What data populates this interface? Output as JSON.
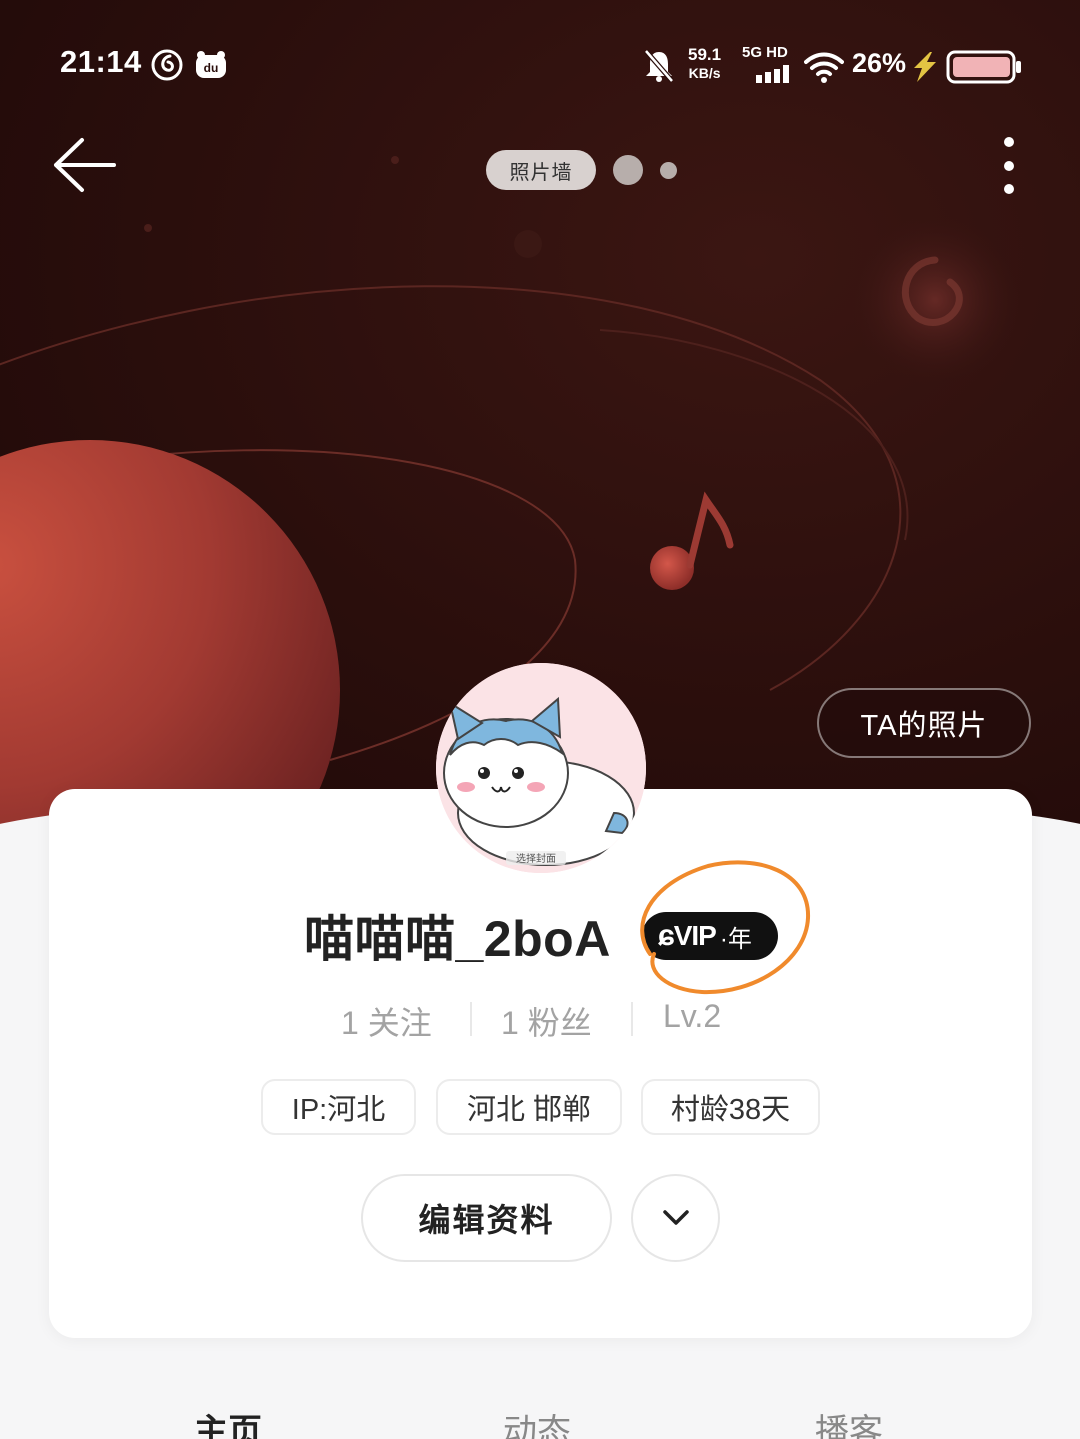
{
  "status_bar": {
    "time": "21:14",
    "speed_value": "59.1",
    "speed_unit": "KB/s",
    "network_top": "5G HD",
    "battery_percent": "26%",
    "icons": [
      "netease-music-icon",
      "du-app-icon",
      "mute-bell-icon",
      "signal-icon",
      "wifi-icon",
      "charging-icon",
      "battery-icon"
    ]
  },
  "nav": {
    "photo_wall_label": "照片墙",
    "ta_photos_label": "TA的照片"
  },
  "profile": {
    "username": "喵喵喵_2boA",
    "vip_label": "VIP",
    "vip_year": "年",
    "stats": [
      {
        "value": "1",
        "label": "关注"
      },
      {
        "value": "1",
        "label": "粉丝"
      },
      {
        "value": "Lv.2",
        "label": ""
      }
    ],
    "tags": [
      "IP:河北",
      "河北 邯郸",
      "村龄38天"
    ],
    "edit_button": "编辑资料",
    "avatar_caption": "选择封面"
  },
  "tabs": [
    {
      "label": "主页",
      "active": true
    },
    {
      "label": "动态",
      "active": false
    },
    {
      "label": "播客",
      "active": false
    }
  ],
  "colors": {
    "hero_background": "#2a0e0c",
    "planet": "#b6453a",
    "annotation_circle": "#f08a2c",
    "vip_badge_bg": "#111111",
    "stat_text": "#a3a3a3"
  }
}
